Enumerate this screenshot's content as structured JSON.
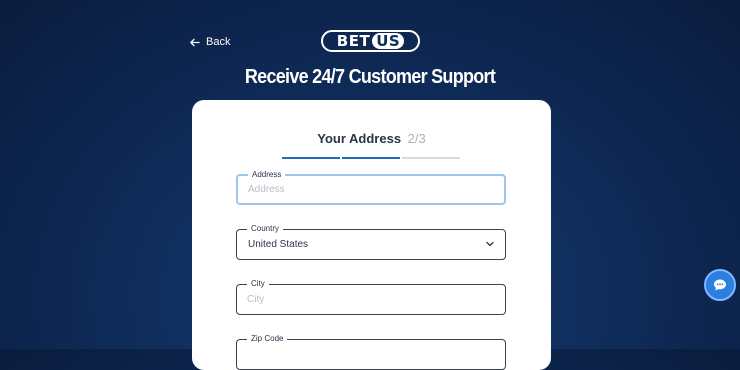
{
  "header": {
    "back_label": "Back",
    "logo_text_left": "BET",
    "logo_text_right": "US",
    "headline": "Receive 24/7 Customer Support"
  },
  "form": {
    "step_title": "Your Address",
    "step_count": "2/3",
    "progress": {
      "completed_steps": 2,
      "total_steps": 3
    },
    "fields": {
      "address": {
        "label": "Address",
        "placeholder": "Address",
        "value": ""
      },
      "country": {
        "label": "Country",
        "value": "United States"
      },
      "city": {
        "label": "City",
        "placeholder": "City",
        "value": ""
      },
      "zip": {
        "label": "Zip Code",
        "value": ""
      }
    }
  },
  "chat_button": {
    "icon": "chat-bubble-icon"
  },
  "colors": {
    "background": "#0f2c5a",
    "progress_active": "#1f6fb8",
    "focus_border": "#9ec6ea",
    "chat_button": "#2a7fe0"
  }
}
